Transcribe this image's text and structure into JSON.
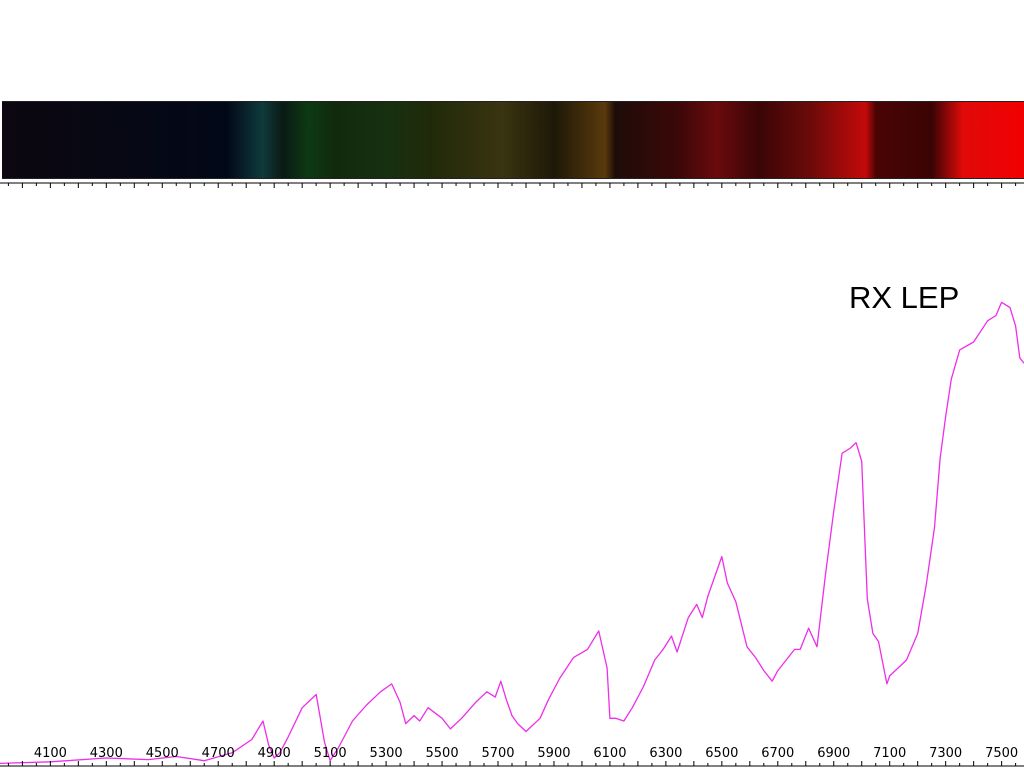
{
  "chart_data": {
    "type": "line",
    "title": "",
    "xlabel": "",
    "ylabel": "",
    "annotation": "RX LEP",
    "xlim": [
      3920,
      7580
    ],
    "ylim": [
      0,
      100
    ],
    "grid": false,
    "legend": "none",
    "x_tick_labels": [
      "4100",
      "4300",
      "4500",
      "4700",
      "4900",
      "5100",
      "5300",
      "5500",
      "5700",
      "5900",
      "6100",
      "6300",
      "6500",
      "6700",
      "6900",
      "7100",
      "7300",
      "7500"
    ],
    "series": [
      {
        "color": "#ee2ee8",
        "x": [
          3920,
          4100,
          4300,
          4450,
          4550,
          4650,
          4750,
          4820,
          4860,
          4880,
          4900,
          4920,
          4950,
          5000,
          5050,
          5080,
          5100,
          5130,
          5180,
          5230,
          5280,
          5320,
          5350,
          5370,
          5400,
          5420,
          5450,
          5500,
          5530,
          5570,
          5620,
          5660,
          5690,
          5710,
          5730,
          5750,
          5770,
          5800,
          5850,
          5880,
          5920,
          5970,
          6020,
          6060,
          6090,
          6100,
          6120,
          6150,
          6180,
          6220,
          6260,
          6290,
          6320,
          6340,
          6380,
          6410,
          6430,
          6450,
          6480,
          6500,
          6520,
          6550,
          6590,
          6620,
          6650,
          6680,
          6700,
          6730,
          6760,
          6780,
          6810,
          6840,
          6870,
          6900,
          6930,
          6960,
          6980,
          7000,
          7020,
          7040,
          7060,
          7090,
          7100,
          7130,
          7160,
          7200,
          7230,
          7260,
          7280,
          7300,
          7320,
          7350,
          7400,
          7450,
          7480,
          7500,
          7530,
          7550,
          7565,
          7580
        ],
        "y": [
          0.5,
          0.8,
          1.5,
          1.2,
          1.8,
          1.0,
          2.5,
          5.0,
          8.5,
          4.0,
          1.5,
          2.5,
          5.5,
          11.0,
          13.5,
          4.5,
          1.0,
          3.5,
          8.5,
          11.5,
          14.0,
          15.5,
          12.0,
          8.0,
          9.5,
          8.5,
          11.0,
          9.0,
          7.0,
          9.0,
          12.0,
          14.0,
          13.0,
          16.0,
          12.5,
          9.5,
          8.0,
          6.5,
          9.0,
          12.5,
          16.5,
          20.5,
          22.0,
          25.5,
          18.5,
          9.0,
          9.0,
          8.5,
          11.0,
          15.0,
          20.0,
          22.0,
          24.5,
          21.5,
          28.0,
          30.5,
          28.0,
          32.0,
          36.5,
          39.5,
          34.5,
          31.0,
          22.5,
          20.5,
          18.0,
          16.0,
          18.0,
          20.0,
          22.0,
          22.0,
          26.0,
          22.5,
          36.0,
          48.0,
          59.0,
          60.0,
          61.0,
          57.5,
          31.5,
          25.0,
          23.5,
          15.5,
          17.0,
          18.5,
          20.0,
          25.0,
          34.0,
          45.0,
          58.0,
          66.0,
          73.0,
          78.5,
          80.0,
          84.0,
          85.0,
          87.5,
          86.5,
          83.0,
          77.0,
          76.0
        ]
      }
    ],
    "spectrum_colors": [
      {
        "stop": 0.0,
        "color": "#0c0710"
      },
      {
        "stop": 0.22,
        "color": "#020818"
      },
      {
        "stop": 0.255,
        "color": "#0f3a3c"
      },
      {
        "stop": 0.275,
        "color": "#0a1a14"
      },
      {
        "stop": 0.3,
        "color": "#0c3a12"
      },
      {
        "stop": 0.325,
        "color": "#112a0c"
      },
      {
        "stop": 0.38,
        "color": "#173010"
      },
      {
        "stop": 0.42,
        "color": "#202a0a"
      },
      {
        "stop": 0.49,
        "color": "#3a3410"
      },
      {
        "stop": 0.54,
        "color": "#1e1808"
      },
      {
        "stop": 0.59,
        "color": "#5a3a0c"
      },
      {
        "stop": 0.6,
        "color": "#1e0c08"
      },
      {
        "stop": 0.66,
        "color": "#3a0808"
      },
      {
        "stop": 0.7,
        "color": "#6a0a0c"
      },
      {
        "stop": 0.74,
        "color": "#3a0506"
      },
      {
        "stop": 0.79,
        "color": "#6a0a0a"
      },
      {
        "stop": 0.845,
        "color": "#c40a0a"
      },
      {
        "stop": 0.855,
        "color": "#4a0404"
      },
      {
        "stop": 0.91,
        "color": "#3a0404"
      },
      {
        "stop": 0.94,
        "color": "#e00a0a"
      },
      {
        "stop": 1.0,
        "color": "#f20000"
      }
    ]
  }
}
